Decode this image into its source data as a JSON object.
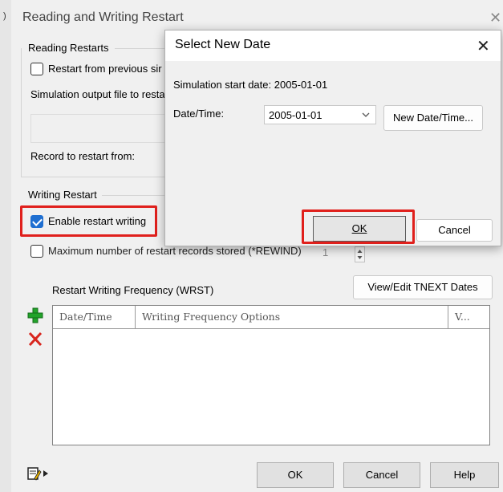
{
  "dialog": {
    "title": "Reading and Writing Restart",
    "reading_restarts": {
      "group_label": "Reading Restarts",
      "restart_checkbox_label": "Restart from previous sir",
      "output_file_label": "Simulation output file to resta",
      "record_label": "Record to restart from:"
    },
    "writing_restart": {
      "group_label": "Writing Restart",
      "enable_label": "Enable restart writing",
      "enable_checked": true,
      "max_records_label": "Maximum number of restart records stored (*REWIND)",
      "max_records_checked": false,
      "max_records_value": "1",
      "frequency_label": "Restart Writing Frequency (WRST)",
      "view_edit_button": "View/Edit TNEXT Dates",
      "table_headers": [
        "Date/Time",
        "Writing Frequency Options",
        "V..."
      ]
    },
    "footer": {
      "ok": "OK",
      "cancel": "Cancel",
      "help": "Help"
    }
  },
  "popup": {
    "title": "Select New Date",
    "start_date_text": "Simulation start date: 2005-01-01",
    "datetime_label": "Date/Time:",
    "datetime_value": "2005-01-01",
    "new_datetime_button": "New Date/Time...",
    "ok_label": "OK",
    "cancel_label": "Cancel"
  },
  "colors": {
    "highlight_red": "#e0201c",
    "checkbox_blue": "#1f6fd1",
    "add_green": "#22a32a",
    "delete_red": "#d8261e"
  }
}
